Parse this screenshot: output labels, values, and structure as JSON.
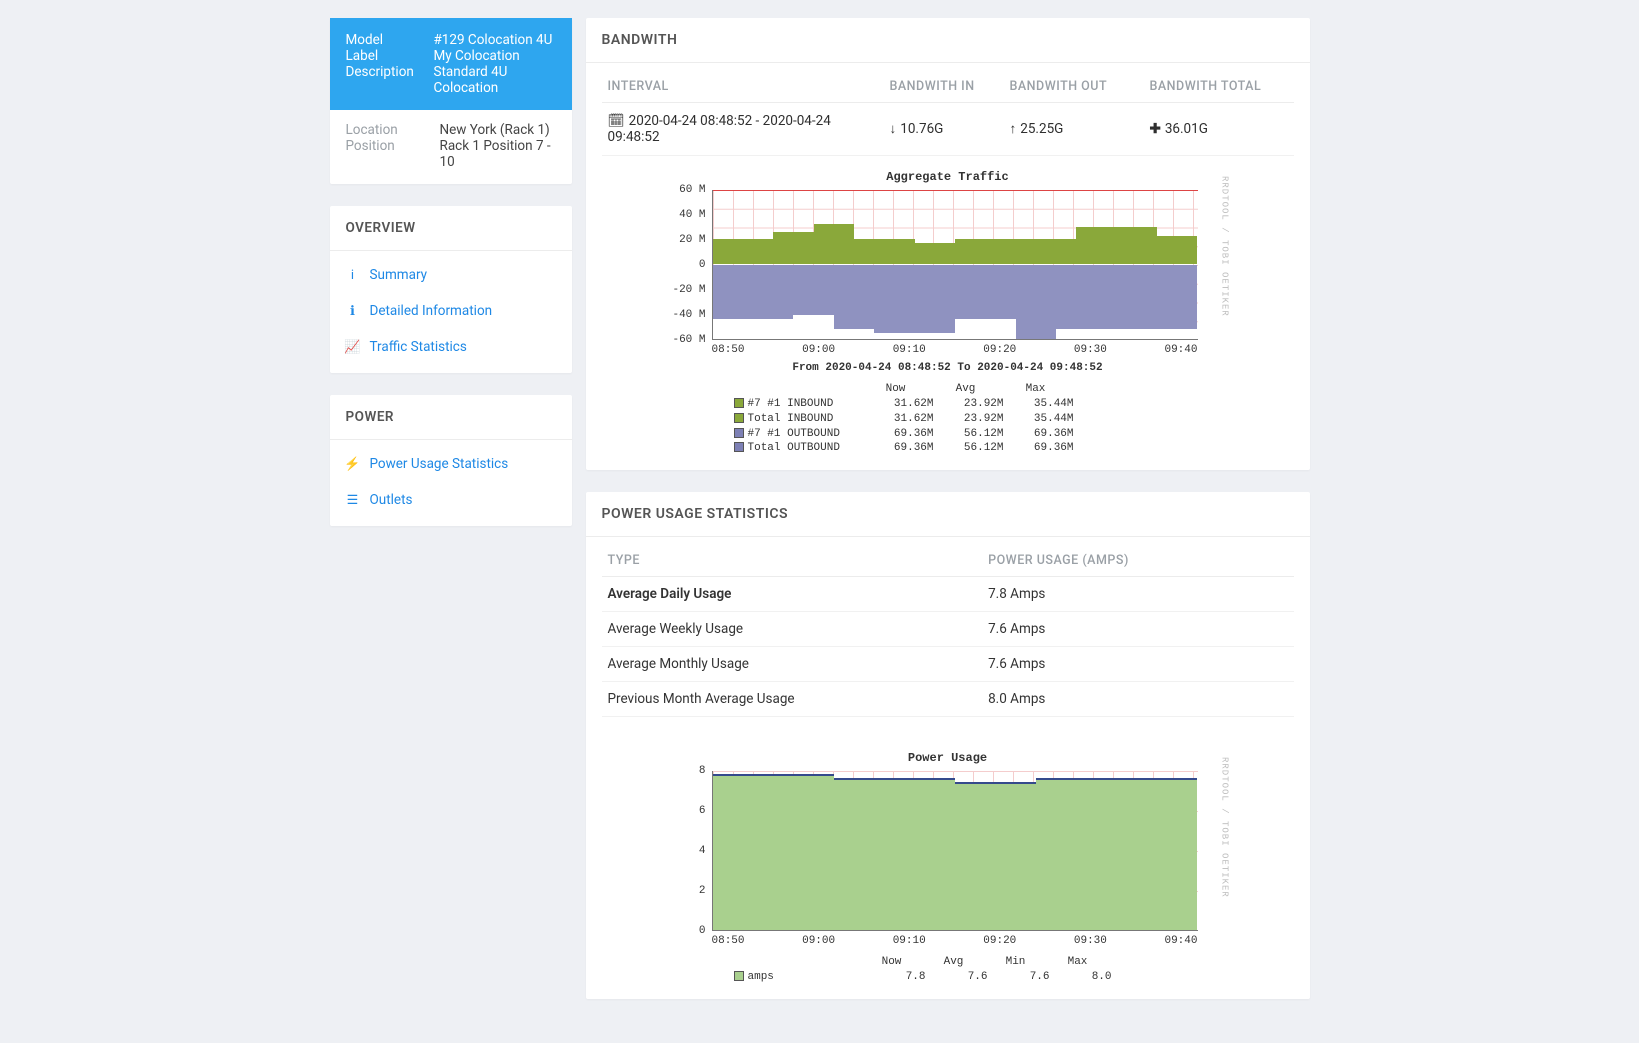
{
  "info": {
    "model_label": "Model",
    "model": "#129 Colocation 4U",
    "label_label": "Label",
    "label": "My Colocation",
    "desc_label": "Description",
    "desc": "Standard 4U Colocation",
    "loc_label": "Location",
    "location": "New York (Rack 1)",
    "pos_label": "Position",
    "position": "Rack 1 Position 7 - 10"
  },
  "sidebar": {
    "overview_title": "OVERVIEW",
    "power_title": "POWER",
    "items": {
      "summary": "Summary",
      "details": "Detailed Information",
      "traffic": "Traffic Statistics",
      "powerstats": "Power Usage Statistics",
      "outlets": "Outlets"
    }
  },
  "bandwidth": {
    "title": "BANDWITH",
    "headers": {
      "interval": "INTERVAL",
      "in": "BANDWITH IN",
      "out": "BANDWITH OUT",
      "total": "BANDWITH TOTAL"
    },
    "row": {
      "interval": "2020-04-24 08:48:52 - 2020-04-24 09:48:52",
      "in": "10.76G",
      "out": "25.25G",
      "total": "36.01G"
    }
  },
  "chart_data": [
    {
      "type": "area",
      "title": "Aggregate Traffic",
      "subtitle": "From 2020-04-24 08:48:52 To 2020-04-24 09:48:52",
      "ylabel": "M",
      "ylim": [
        -60,
        60
      ],
      "yticks": [
        "60 M",
        "40 M",
        "20 M",
        "0",
        "-20 M",
        "-40 M",
        "-60 M"
      ],
      "xticks": [
        "08:50",
        "09:00",
        "09:10",
        "09:20",
        "09:30",
        "09:40"
      ],
      "series": [
        {
          "name": "#7 #1 INBOUND",
          "color": "#8aa83a",
          "now": "31.62M",
          "avg": "23.92M",
          "max": "35.44M",
          "values": [
            22,
            22,
            22,
            28,
            28,
            35,
            35,
            22,
            22,
            22,
            18,
            18,
            22,
            22,
            22,
            22,
            22,
            22,
            32,
            32,
            32,
            32,
            24,
            24
          ]
        },
        {
          "name": "Total INBOUND",
          "color": "#8aa83a",
          "now": "31.62M",
          "avg": "23.92M",
          "max": "35.44M"
        },
        {
          "name": "#7 #1 OUTBOUND",
          "color": "#7d80b5",
          "now": "69.36M",
          "avg": "56.12M",
          "max": "69.36M",
          "values": [
            -48,
            -48,
            -48,
            -48,
            -44,
            -44,
            -56,
            -56,
            -60,
            -60,
            -60,
            -60,
            -48,
            -48,
            -48,
            -69,
            -69,
            -56,
            -56,
            -56,
            -56,
            -56,
            -56,
            -56
          ]
        },
        {
          "name": "Total OUTBOUND",
          "color": "#7d80b5",
          "now": "69.36M",
          "avg": "56.12M",
          "max": "69.36M"
        }
      ],
      "threshold": 60
    },
    {
      "type": "area",
      "title": "Power Usage",
      "ylabel": "",
      "ylim": [
        0,
        8
      ],
      "yticks": [
        "8",
        "6",
        "4",
        "2",
        "0"
      ],
      "xticks": [
        "08:50",
        "09:00",
        "09:10",
        "09:20",
        "09:30",
        "09:40"
      ],
      "series": [
        {
          "name": "amps",
          "color": "#a9d08e",
          "now": "7.8",
          "avg": "7.6",
          "min": "7.6",
          "max": "8.0",
          "values": [
            8.0,
            8.0,
            8.0,
            8.0,
            8.0,
            8.0,
            7.8,
            7.8,
            7.8,
            7.8,
            7.8,
            7.8,
            7.6,
            7.6,
            7.6,
            7.6,
            7.8,
            7.8,
            7.8,
            7.8,
            7.8,
            7.8,
            7.8,
            7.8
          ]
        }
      ]
    }
  ],
  "traffic_legend": {
    "cols": [
      "Now",
      "Avg",
      "Max"
    ],
    "rrdtool": "RRDTOOL / TOBI OETIKER"
  },
  "power": {
    "title": "POWER USAGE STATISTICS",
    "headers": {
      "type": "TYPE",
      "usage": "POWER USAGE (AMPS)"
    },
    "rows": [
      {
        "type": "Average Daily Usage",
        "usage": "7.8 Amps",
        "bold": true
      },
      {
        "type": "Average Weekly Usage",
        "usage": "7.6 Amps"
      },
      {
        "type": "Average Monthly Usage",
        "usage": "7.6 Amps"
      },
      {
        "type": "Previous Month Average Usage",
        "usage": "8.0 Amps"
      }
    ],
    "legend_cols": [
      "Now",
      "Avg",
      "Min",
      "Max"
    ],
    "legend_label": "amps"
  }
}
